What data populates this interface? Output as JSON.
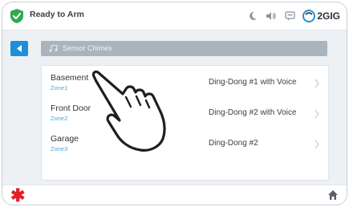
{
  "status": {
    "label": "Ready to Arm",
    "color": "#33a852"
  },
  "top_icons": [
    "moon-icon",
    "speaker-icon",
    "chat-icon"
  ],
  "brand": {
    "name": "2GIG",
    "color": "#2a8fd4"
  },
  "header": {
    "title": "Sensor Chimes",
    "icon": "music-note-icon"
  },
  "sensors": [
    {
      "name": "Basement",
      "zone": "Zone1",
      "chime": "Ding-Dong #1 with Voice"
    },
    {
      "name": "Front Door",
      "zone": "Zone2",
      "chime": "Ding-Dong #2 with Voice"
    },
    {
      "name": "Garage",
      "zone": "Zone3",
      "chime": "Ding-Dong #2"
    }
  ],
  "colors": {
    "accent": "#1e8fd6",
    "emergency": "#e21f26"
  }
}
